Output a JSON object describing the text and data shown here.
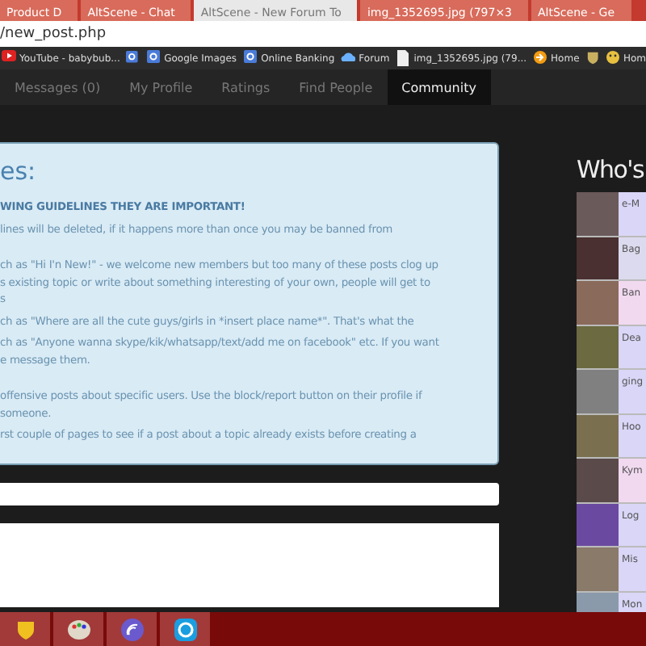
{
  "browser_tabs": [
    {
      "title": "Product D",
      "selected": false
    },
    {
      "title": "AltScene - Chat",
      "selected": false
    },
    {
      "title": "AltScene - New Forum To",
      "selected": true
    },
    {
      "title": "img_1352695.jpg (797×3",
      "selected": false
    },
    {
      "title": "AltScene - Ge",
      "selected": false
    }
  ],
  "address_bar": {
    "value": "/new_post.php"
  },
  "bookmarks": [
    {
      "kind": "video",
      "label": "YouTube - babybub..."
    },
    {
      "kind": "search"
    },
    {
      "kind": "search",
      "label": "Google Images"
    },
    {
      "kind": "search",
      "label": "Online Banking"
    },
    {
      "kind": "cloud",
      "label": "Forum"
    },
    {
      "kind": "page",
      "label": "img_1352695.jpg (79..."
    },
    {
      "kind": "arrow",
      "label": "Home"
    },
    {
      "kind": "shield"
    },
    {
      "kind": "face",
      "label": "Hom"
    }
  ],
  "nav": [
    {
      "label": "Messages (0)",
      "selected": false
    },
    {
      "label": "My Profile",
      "selected": false
    },
    {
      "label": "Ratings",
      "selected": false
    },
    {
      "label": "Find People",
      "selected": false
    },
    {
      "label": "Community",
      "selected": true
    }
  ],
  "rules_panel": {
    "title": "es:",
    "paragraphs": [
      {
        "kind": "heading",
        "lines": [
          "WING GUIDELINES THEY ARE IMPORTANT!"
        ]
      },
      {
        "kind": "text",
        "lines": [
          "lines will be deleted, if it happens more than once you may be banned from"
        ]
      },
      {
        "kind": "text",
        "lines": [
          "ch as \"Hi I'n New!\" - we welcome new members but too many of these posts clog up",
          "s existing topic or write about something interesting of your own, people will get to",
          "s"
        ]
      },
      {
        "kind": "text",
        "lines": [
          "ch as \"Where are all the cute guys/girls in *insert place name*\". That's what the"
        ]
      },
      {
        "kind": "text",
        "lines": [
          "ch as \"Anyone wanna skype/kik/whatsapp/text/add me on facebook\" etc. If you want",
          "e message them."
        ]
      },
      {
        "kind": "text",
        "lines": [
          "offensive posts about specific users. Use the block/report button on their profile if",
          "someone."
        ]
      },
      {
        "kind": "text",
        "lines": [
          "rst couple of pages to see if a post about a topic already exists before creating a"
        ]
      }
    ]
  },
  "whos_online": {
    "title": "Who's",
    "users": [
      {
        "name": "e-M",
        "color": "#d9d6f7"
      },
      {
        "name": "Bag",
        "color": "#dcdaee"
      },
      {
        "name": "Ban",
        "color": "#f1d9f0"
      },
      {
        "name": "Dea",
        "color": "#d9d6f7"
      },
      {
        "name": "ging",
        "color": "#d9d6f7"
      },
      {
        "name": "Hoo",
        "color": "#d9d6f7"
      },
      {
        "name": "Kym",
        "color": "#f1d9f0"
      },
      {
        "name": "Log",
        "color": "#d9d6f7"
      },
      {
        "name": "Mis",
        "color": "#d9d6f7"
      },
      {
        "name": "Mon",
        "color": "#d9d6f7"
      }
    ]
  },
  "taskbar": [
    {
      "kind": "shield"
    },
    {
      "kind": "palette"
    },
    {
      "kind": "torrent"
    },
    {
      "kind": "skype"
    }
  ]
}
